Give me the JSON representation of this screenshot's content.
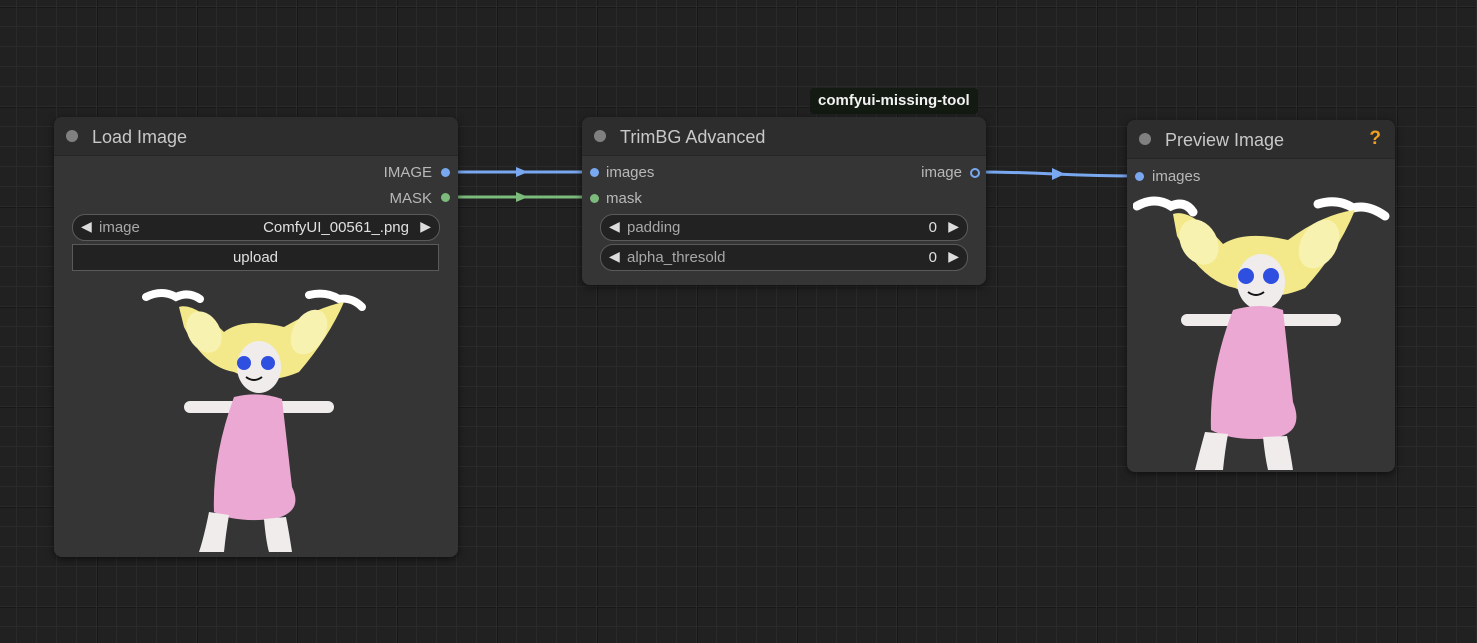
{
  "nodes": {
    "load_image": {
      "title": "Load Image",
      "outputs": [
        "IMAGE",
        "MASK"
      ],
      "image_widget": {
        "label": "image",
        "value": "ComfyUI_00561_.png"
      },
      "upload_label": "upload"
    },
    "trimbg": {
      "title": "TrimBG Advanced",
      "badge": "comfyui-missing-tool",
      "inputs": [
        "images",
        "mask"
      ],
      "output": "image",
      "padding": {
        "label": "padding",
        "value": "0"
      },
      "alpha": {
        "label": "alpha_thresold",
        "value": "0"
      }
    },
    "preview": {
      "title": "Preview Image",
      "input": "images",
      "help_icon": "?"
    }
  },
  "colors": {
    "image_link": "#7aa8f0",
    "mask_link": "#7dbb7d",
    "help": "#f0a020"
  },
  "icons": [
    "left-arrow-icon",
    "right-arrow-icon",
    "help-icon",
    "node-dot-icon"
  ]
}
